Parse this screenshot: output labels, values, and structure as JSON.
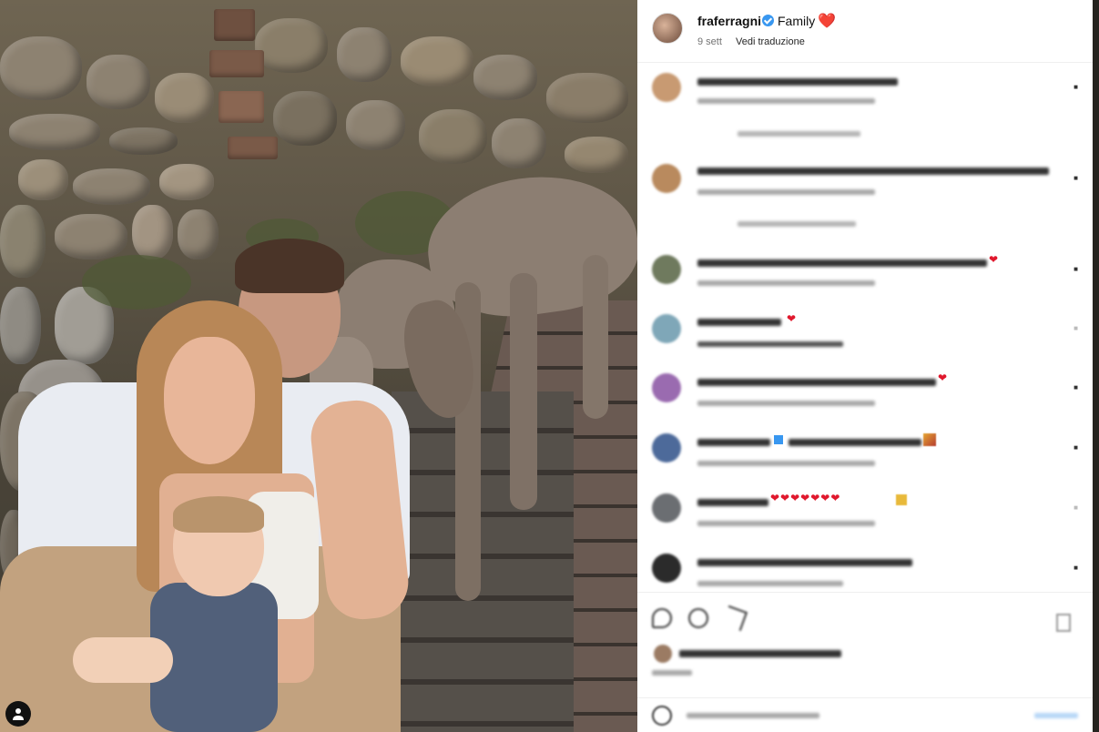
{
  "post": {
    "username": "fraferragni",
    "caption": "Family",
    "caption_emoji": "❤️",
    "time": "9 sett",
    "translate_label": "Vedi traduzione"
  },
  "icons": [
    "verified-badge-icon",
    "heart-icon",
    "like-icon",
    "comment-icon",
    "share-icon",
    "bookmark-icon",
    "emoji-icon",
    "profile-icon"
  ],
  "colors": {
    "verified": "#3897f0",
    "heart": "#e0182d",
    "panel_bg": "#ffffff",
    "secondary_text": "#737373"
  }
}
